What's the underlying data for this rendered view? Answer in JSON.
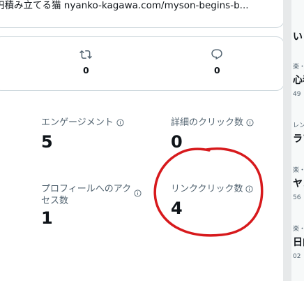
{
  "tweet": {
    "snippet": "円積み立てる猫 nyanko-kagawa.com/myson-begins-b..."
  },
  "metrics": {
    "retweet_count": "0",
    "reply_count": "0"
  },
  "stats": [
    {
      "label": "エンゲージメント",
      "value": "5"
    },
    {
      "label": "詳細のクリック数",
      "value": "0"
    },
    {
      "label": "プロフィールへのアクセス数",
      "value": "1"
    },
    {
      "label": "リンククリック数",
      "value": "4"
    }
  ],
  "side_panel": {
    "items": [
      {
        "small": "楽・",
        "big": "い"
      },
      {
        "small": "楽・",
        "big": "心春"
      },
      {
        "small": "49",
        "big": ""
      },
      {
        "small": "レン",
        "big": "ラブ"
      },
      {
        "small": "楽・",
        "big": "ヤン"
      },
      {
        "small": "56",
        "big": ""
      },
      {
        "small": "楽・",
        "big": "日向"
      },
      {
        "small": "02",
        "big": ""
      }
    ]
  },
  "colors": {
    "annotation": "#d7191c",
    "border": "#cfd9de",
    "secondary_text": "#536471"
  }
}
